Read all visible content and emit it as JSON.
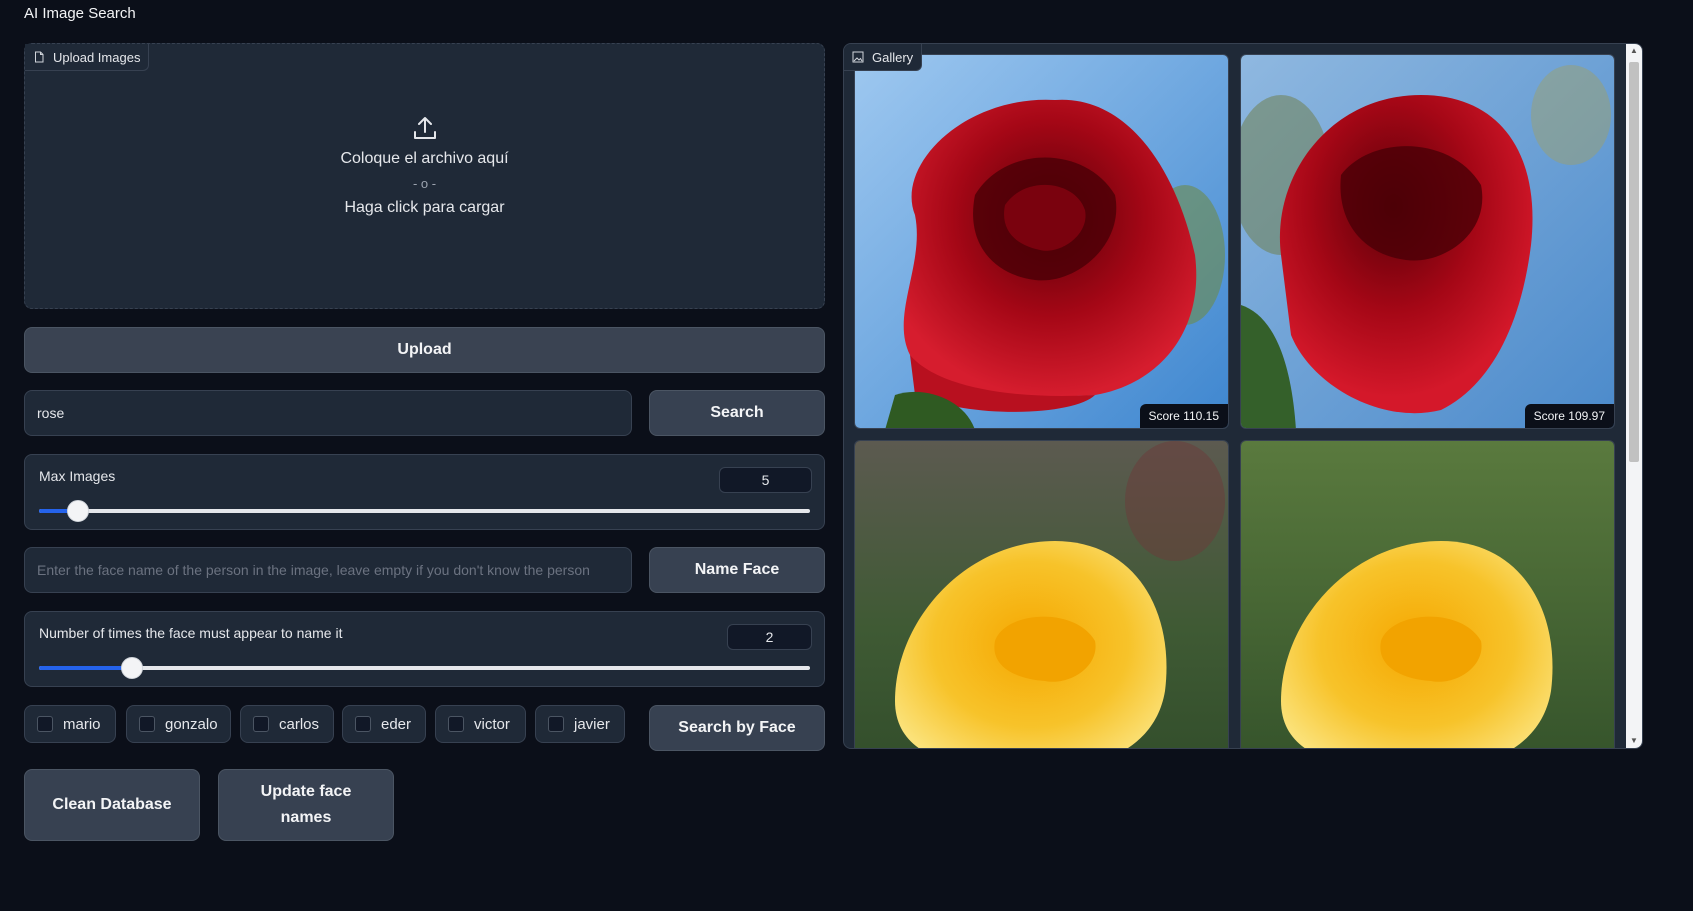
{
  "app": {
    "title": "AI Image Search"
  },
  "upload": {
    "label": "Upload Images",
    "drop_text": "Coloque el archivo aquí",
    "or_text": "- o -",
    "click_text": "Haga click para cargar",
    "button_label": "Upload"
  },
  "search": {
    "query_value": "rose",
    "button_label": "Search"
  },
  "max_images": {
    "label": "Max Images",
    "value": "5",
    "min": 1,
    "max": 100,
    "fraction": 0.05
  },
  "face_name": {
    "placeholder": "Enter the face name of the person in the image, leave empty if you don't know the person",
    "button_label": "Name Face"
  },
  "face_count": {
    "label": "Number of times the face must appear to name it",
    "value": "2",
    "fraction": 0.12
  },
  "faces": {
    "options": [
      {
        "label": "mario",
        "checked": false
      },
      {
        "label": "gonzalo",
        "checked": false
      },
      {
        "label": "carlos",
        "checked": false
      },
      {
        "label": "eder",
        "checked": false
      },
      {
        "label": "victor",
        "checked": false
      },
      {
        "label": "javier",
        "checked": false
      }
    ],
    "button_label": "Search by Face"
  },
  "actions": {
    "clean_label": "Clean Database",
    "update_label": "Update face names"
  },
  "gallery": {
    "label": "Gallery",
    "items": [
      {
        "caption": "Score 110.15",
        "subject": "red rose"
      },
      {
        "caption": "Score 109.97",
        "subject": "red rose"
      },
      {
        "caption": "",
        "subject": "yellow rose"
      },
      {
        "caption": "",
        "subject": "yellow rose"
      }
    ]
  },
  "colors": {
    "background": "#0b0f19",
    "panel": "#1f2937",
    "slider_accent": "#2563eb"
  }
}
